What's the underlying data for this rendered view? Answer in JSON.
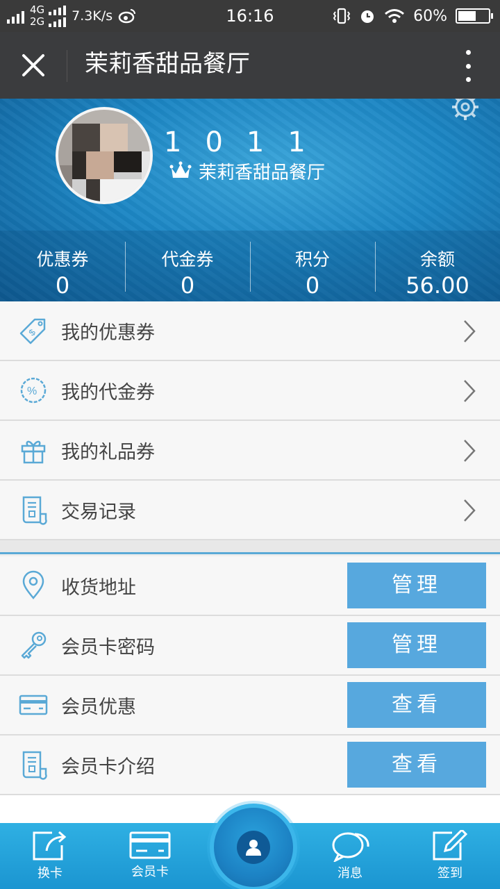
{
  "status_bar": {
    "net_top": "4G",
    "net_bottom": "2G",
    "speed": "7.3K/s",
    "time": "16:16",
    "battery": "60%",
    "battery_level": 0.6
  },
  "title_bar": {
    "title": "茉莉香甜品餐厅"
  },
  "profile": {
    "user_no": "1011",
    "shop_name": "茉莉香甜品餐厅"
  },
  "stats": [
    {
      "label": "优惠券",
      "value": "0"
    },
    {
      "label": "代金券",
      "value": "0"
    },
    {
      "label": "积分",
      "value": "0"
    },
    {
      "label": "余额",
      "value": "56.00"
    }
  ],
  "menu": [
    {
      "label": "我的优惠券",
      "icon": "coupon-tag-icon"
    },
    {
      "label": "我的代金券",
      "icon": "percent-badge-icon"
    },
    {
      "label": "我的礼品券",
      "icon": "gift-icon"
    },
    {
      "label": "交易记录",
      "icon": "scroll-receipt-icon"
    }
  ],
  "settings": [
    {
      "label": "收货地址",
      "icon": "location-pin-icon",
      "button": "管理"
    },
    {
      "label": "会员卡密码",
      "icon": "key-icon",
      "button": "管理"
    },
    {
      "label": "会员优惠",
      "icon": "card-icon",
      "button": "查看"
    },
    {
      "label": "会员卡介绍",
      "icon": "scroll-receipt-icon",
      "button": "查看"
    }
  ],
  "tabs": [
    {
      "label": "换卡",
      "icon": "share-card-icon"
    },
    {
      "label": "会员卡",
      "icon": "card-icon"
    },
    {
      "label": "",
      "icon": "user-icon"
    },
    {
      "label": "消息",
      "icon": "chat-bubbles-icon"
    },
    {
      "label": "签到",
      "icon": "edit-icon"
    }
  ],
  "colors": {
    "accent": "#57a8de",
    "banner": "#1c86c4",
    "tabbar": "#22a3da",
    "icon": "#5aa9d6"
  }
}
